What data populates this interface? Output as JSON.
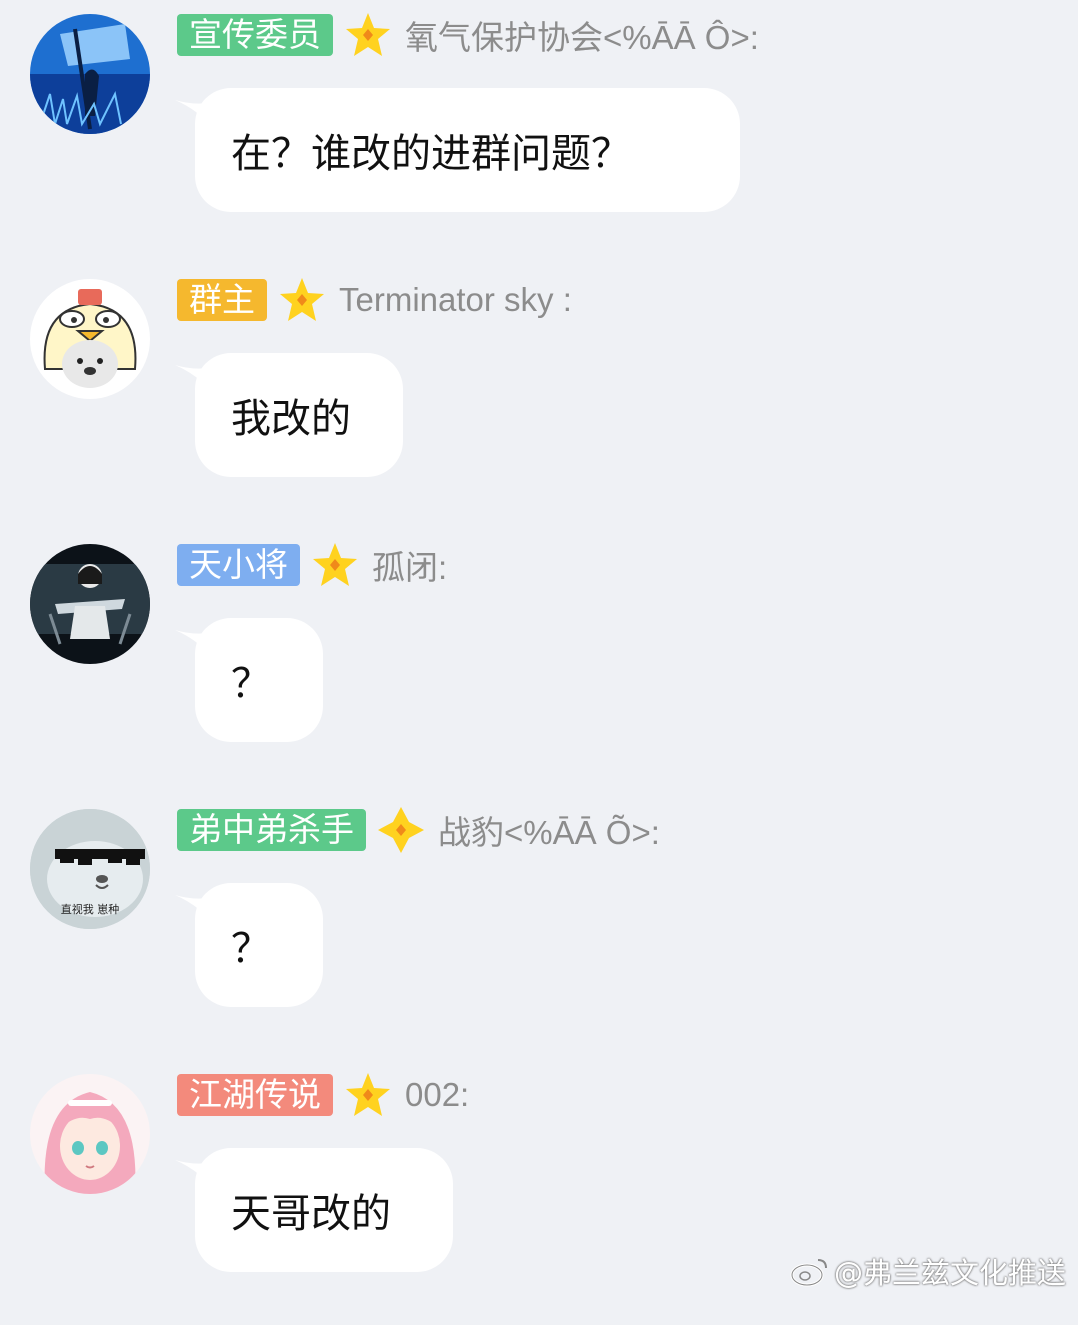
{
  "messages": [
    {
      "badge": "宣传委员",
      "badge_color": "#5cc98a",
      "sender": "氧气保护协会<%ĀĀ Ô>:",
      "text": "在？谁改的进群问题？",
      "avatar": "blue-flag-avatar"
    },
    {
      "badge": "群主",
      "badge_color": "#f5b82e",
      "sender": "Terminator sky :",
      "text": "我改的",
      "avatar": "seal-chicken-hat-avatar"
    },
    {
      "badge": "天小将",
      "badge_color": "#7eaef0",
      "sender": "孤闭:",
      "text": "？",
      "avatar": "dark-girl-avatar"
    },
    {
      "badge": "弟中弟杀手",
      "badge_color": "#5cc98a",
      "sender": "战豹<%ĀĀ Õ>:",
      "text": "？",
      "avatar": "seal-sunglasses-avatar",
      "avatar_caption": "直视我 崽种"
    },
    {
      "badge": "江湖传说",
      "badge_color": "#f38a7c",
      "sender": "002:",
      "text": "天哥改的",
      "avatar": "pink-hair-girl-avatar"
    }
  ],
  "watermark": {
    "text": "@弗兰兹文化推送",
    "icon": "weibo-icon"
  },
  "colors": {
    "background": "#eff1f5",
    "bubble": "#ffffff",
    "star": "#ffd21f",
    "star_center": "#f08a1a"
  }
}
